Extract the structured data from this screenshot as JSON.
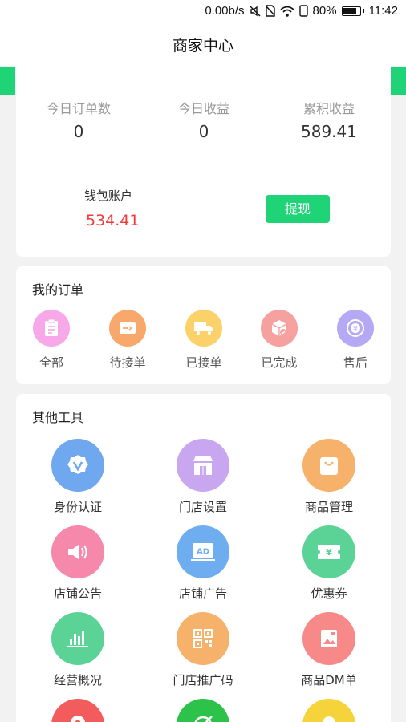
{
  "status_bar": {
    "speed": "0.00b/s",
    "battery": "80%",
    "time": "11:42",
    "icons": [
      "mute-icon",
      "no-sim-icon",
      "wifi-icon",
      "portrait-lock-icon",
      "battery-icon"
    ]
  },
  "header": {
    "title": "商家中心"
  },
  "stats": [
    {
      "label": "今日订单数",
      "value": "0"
    },
    {
      "label": "今日收益",
      "value": "0"
    },
    {
      "label": "累积收益",
      "value": "589.41"
    }
  ],
  "wallet": {
    "label": "钱包账户",
    "value": "534.41",
    "withdraw_label": "提现"
  },
  "orders": {
    "title": "我的订单",
    "items": [
      {
        "label": "全部",
        "icon": "clipboard-icon",
        "color": "#f7a8e8"
      },
      {
        "label": "待接单",
        "icon": "pending-order-icon",
        "color": "#f9a86b"
      },
      {
        "label": "已接单",
        "icon": "delivery-truck-icon",
        "color": "#fbd26a"
      },
      {
        "label": "已完成",
        "icon": "completed-box-icon",
        "color": "#f7a0a0"
      },
      {
        "label": "售后",
        "icon": "after-sales-icon",
        "color": "#b5a8f5"
      }
    ]
  },
  "tools": {
    "title": "其他工具",
    "items": [
      {
        "label": "身份认证",
        "icon": "verification-badge-icon",
        "color": "#6fa8ee"
      },
      {
        "label": "门店设置",
        "icon": "storefront-icon",
        "color": "#c8a6f0"
      },
      {
        "label": "商品管理",
        "icon": "shopping-bag-icon",
        "color": "#f6b16a"
      },
      {
        "label": "店铺公告",
        "icon": "speaker-icon",
        "color": "#f689ab"
      },
      {
        "label": "店铺广告",
        "icon": "ad-icon",
        "color": "#6eaef0"
      },
      {
        "label": "优惠券",
        "icon": "coupon-icon",
        "color": "#5cd396"
      },
      {
        "label": "经营概况",
        "icon": "bar-chart-icon",
        "color": "#5cd396"
      },
      {
        "label": "门店推广码",
        "icon": "qr-code-icon",
        "color": "#f6b16a"
      },
      {
        "label": "商品DM单",
        "icon": "image-flyer-icon",
        "color": "#f78989"
      },
      {
        "label": "",
        "icon": "location-pin-icon",
        "color": "#f25c5c"
      },
      {
        "label": "",
        "icon": "target-icon",
        "color": "#2dc24a"
      },
      {
        "label": "",
        "icon": "lightbulb-icon",
        "color": "#f5d33a"
      }
    ]
  }
}
